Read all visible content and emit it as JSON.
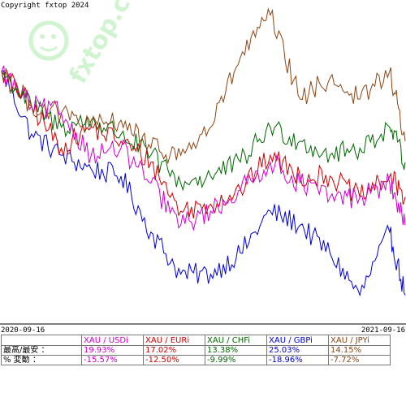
{
  "header": {
    "copyright": "Copyright fxtop 2024"
  },
  "watermark": {
    "text": "fxtop.com",
    "color": "#99e699"
  },
  "chart_data": {
    "type": "line",
    "x_start_label": "2020-09-16",
    "x_end_label": "2021-09-16",
    "xlim": [
      "2020-09-16",
      "2021-09-16"
    ],
    "ylim": [
      76,
      121
    ],
    "grid": false,
    "legend": "table-below",
    "series": [
      {
        "name": "XAU / USDi",
        "color": "#0000cc",
        "max_change": "25.03%",
        "min_change": "-18.96%",
        "x": [
          "2020-09-16",
          "2020-10-13",
          "2020-11-09",
          "2020-12-06",
          "2021-01-02",
          "2021-01-29",
          "2021-02-25",
          "2021-03-24",
          "2021-04-20",
          "2021-05-17",
          "2021-06-13",
          "2021-07-10",
          "2021-08-06",
          "2021-09-02",
          "2021-09-16"
        ],
        "values": [
          112,
          103,
          100,
          98,
          97,
          89,
          83,
          83,
          86,
          92,
          90,
          86,
          80,
          89,
          80
        ]
      },
      {
        "name": "XAU / EURi",
        "color": "#cc0000",
        "max_change": "17.02%",
        "min_change": "-12.50%",
        "x": [
          "2020-09-16",
          "2020-10-13",
          "2020-11-09",
          "2020-12-06",
          "2021-01-02",
          "2021-01-29",
          "2021-02-25",
          "2021-03-24",
          "2021-04-20",
          "2021-05-17",
          "2021-06-13",
          "2021-07-10",
          "2021-08-06",
          "2021-09-02",
          "2021-09-16"
        ],
        "values": [
          112,
          107,
          101,
          104,
          102,
          99,
          92,
          93,
          95,
          100,
          97,
          97,
          94,
          97,
          94
        ]
      },
      {
        "name": "XAU / CHFi",
        "color": "#006600",
        "max_change": "13.38%",
        "min_change": "-9.99%",
        "x": [
          "2020-09-16",
          "2020-10-13",
          "2020-11-09",
          "2020-12-06",
          "2021-01-02",
          "2021-01-29",
          "2021-02-25",
          "2021-03-24",
          "2021-04-20",
          "2021-05-17",
          "2021-06-13",
          "2021-07-10",
          "2021-08-06",
          "2021-09-02",
          "2021-09-16"
        ],
        "values": [
          112,
          107,
          104,
          105,
          103,
          100,
          96,
          97,
          99,
          104,
          102,
          100,
          101,
          104,
          99
        ]
      },
      {
        "name": "XAU / GBPi",
        "color": "#cc00cc",
        "max_change": "14.15%",
        "min_change": "-15.57%",
        "x": [
          "2020-09-16",
          "2020-10-13",
          "2020-11-09",
          "2020-12-06",
          "2021-01-02",
          "2021-01-29",
          "2021-02-25",
          "2021-03-24",
          "2021-04-20",
          "2021-05-17",
          "2021-06-13",
          "2021-07-10",
          "2021-08-06",
          "2021-09-02",
          "2021-09-16"
        ],
        "values": [
          112,
          107,
          106,
          100,
          101,
          96,
          90,
          92,
          95,
          99,
          96,
          94,
          94,
          96,
          90
        ]
      },
      {
        "name": "XAU / JPYi",
        "color": "#8b4513",
        "max_change": "14.15%",
        "min_change": "-7.72%",
        "x": [
          "2020-09-16",
          "2020-10-13",
          "2020-11-09",
          "2020-12-06",
          "2021-01-02",
          "2021-01-29",
          "2021-02-25",
          "2021-03-24",
          "2021-04-20",
          "2021-05-17",
          "2021-06-13",
          "2021-07-10",
          "2021-08-06",
          "2021-09-02",
          "2021-09-16"
        ],
        "values": [
          112,
          107,
          106,
          104,
          105,
          101,
          100,
          104,
          114,
          120,
          108,
          111,
          108,
          112,
          102
        ]
      }
    ]
  },
  "table": {
    "headers": [
      "",
      "XAU / USDi",
      "XAU / EURi",
      "XAU / CHFi",
      "XAU / GBPi",
      "XAU / JPYi"
    ],
    "header_colors": [
      "#cc00cc",
      "#cc0000",
      "#006600",
      "#0000cc",
      "#8b4513"
    ],
    "row_max": {
      "label": "最高/最安 ：",
      "values": [
        "19.93%",
        "17.02%",
        "13.38%",
        "25.03%",
        "14.15%"
      ]
    },
    "row_min": {
      "label": "% 変動 ：",
      "values": [
        "-15.57%",
        "-12.50%",
        "-9.99%",
        "-18.96%",
        "-7.72%"
      ]
    }
  }
}
